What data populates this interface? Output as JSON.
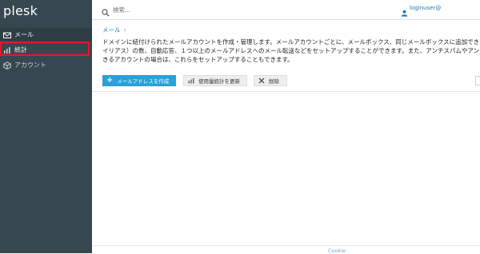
{
  "app": {
    "logo": "plesk"
  },
  "sidebar": {
    "items": [
      {
        "label": "メール",
        "icon": "mail-icon"
      },
      {
        "label": "統計",
        "icon": "chart-icon"
      },
      {
        "label": "アカウント",
        "icon": "box-icon"
      }
    ]
  },
  "topbar": {
    "search_placeholder": "検索...",
    "user": "loginuser@"
  },
  "breadcrumb": {
    "label": "メール",
    "separator": "›"
  },
  "description": {
    "lines": [
      "ドメインに紐付けられたメールアカウントを作成・管理します。メールアカウントごとに、メールボックス、同じメールボックスに追加でき",
      "イリアス）の数、自動応答、１つ以上のメールアドレスへのメール転送などをセットアップすることができます。また、アンチスパムやアン",
      "きるアカウントの場合は、これらをセットアップすることもできます。"
    ]
  },
  "toolbar": {
    "create_label": "メールアドレスを作成",
    "update_label": "使用量統計を更新",
    "delete_label": "削除"
  },
  "footer": {
    "text": "Cookie"
  },
  "colors": {
    "sidebar_bg": "#37474f",
    "accent": "#2d9fd9",
    "link": "#1b75bb",
    "highlight": "#e01b24"
  }
}
